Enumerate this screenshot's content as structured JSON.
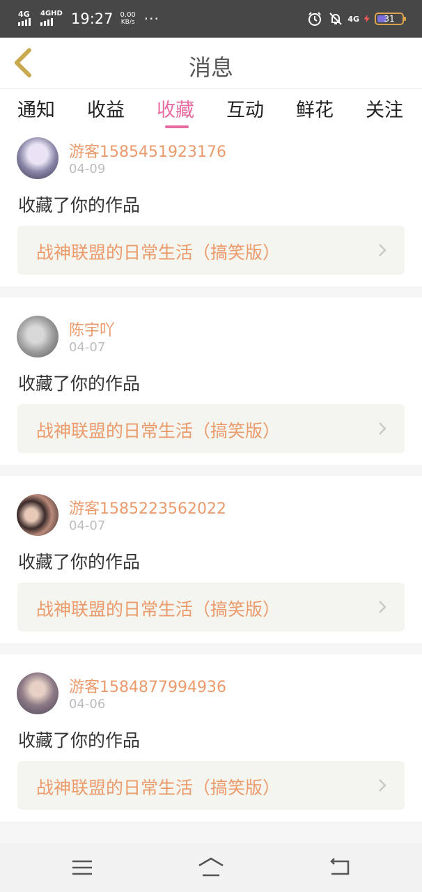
{
  "status_bar": {
    "signal1": "4G",
    "signal2": "4GHD",
    "time": "19:27",
    "speed_value": "0.00",
    "speed_unit": "KB/s",
    "more": "···",
    "net": "4G",
    "battery": "31"
  },
  "header": {
    "title": "消息"
  },
  "tabs": [
    {
      "label": "通知",
      "active": false
    },
    {
      "label": "收益",
      "active": false
    },
    {
      "label": "收藏",
      "active": true
    },
    {
      "label": "互动",
      "active": false
    },
    {
      "label": "鲜花",
      "active": false
    },
    {
      "label": "关注",
      "active": false
    }
  ],
  "messages": [
    {
      "user": "游客1585451923176",
      "date": "04-09",
      "text": "收藏了你的作品",
      "work": "战神联盟的日常生活（搞笑版）"
    },
    {
      "user": "陈宇吖",
      "date": "04-07",
      "text": "收藏了你的作品",
      "work": "战神联盟的日常生活（搞笑版）"
    },
    {
      "user": "游客1585223562022",
      "date": "04-07",
      "text": "收藏了你的作品",
      "work": "战神联盟的日常生活（搞笑版）"
    },
    {
      "user": "游客1584877994936",
      "date": "04-06",
      "text": "收藏了你的作品",
      "work": "战神联盟的日常生活（搞笑版）"
    }
  ],
  "colors": {
    "accent": "#e76aa0",
    "username": "#eb9a6c",
    "work_bg": "#f5f5ef"
  }
}
